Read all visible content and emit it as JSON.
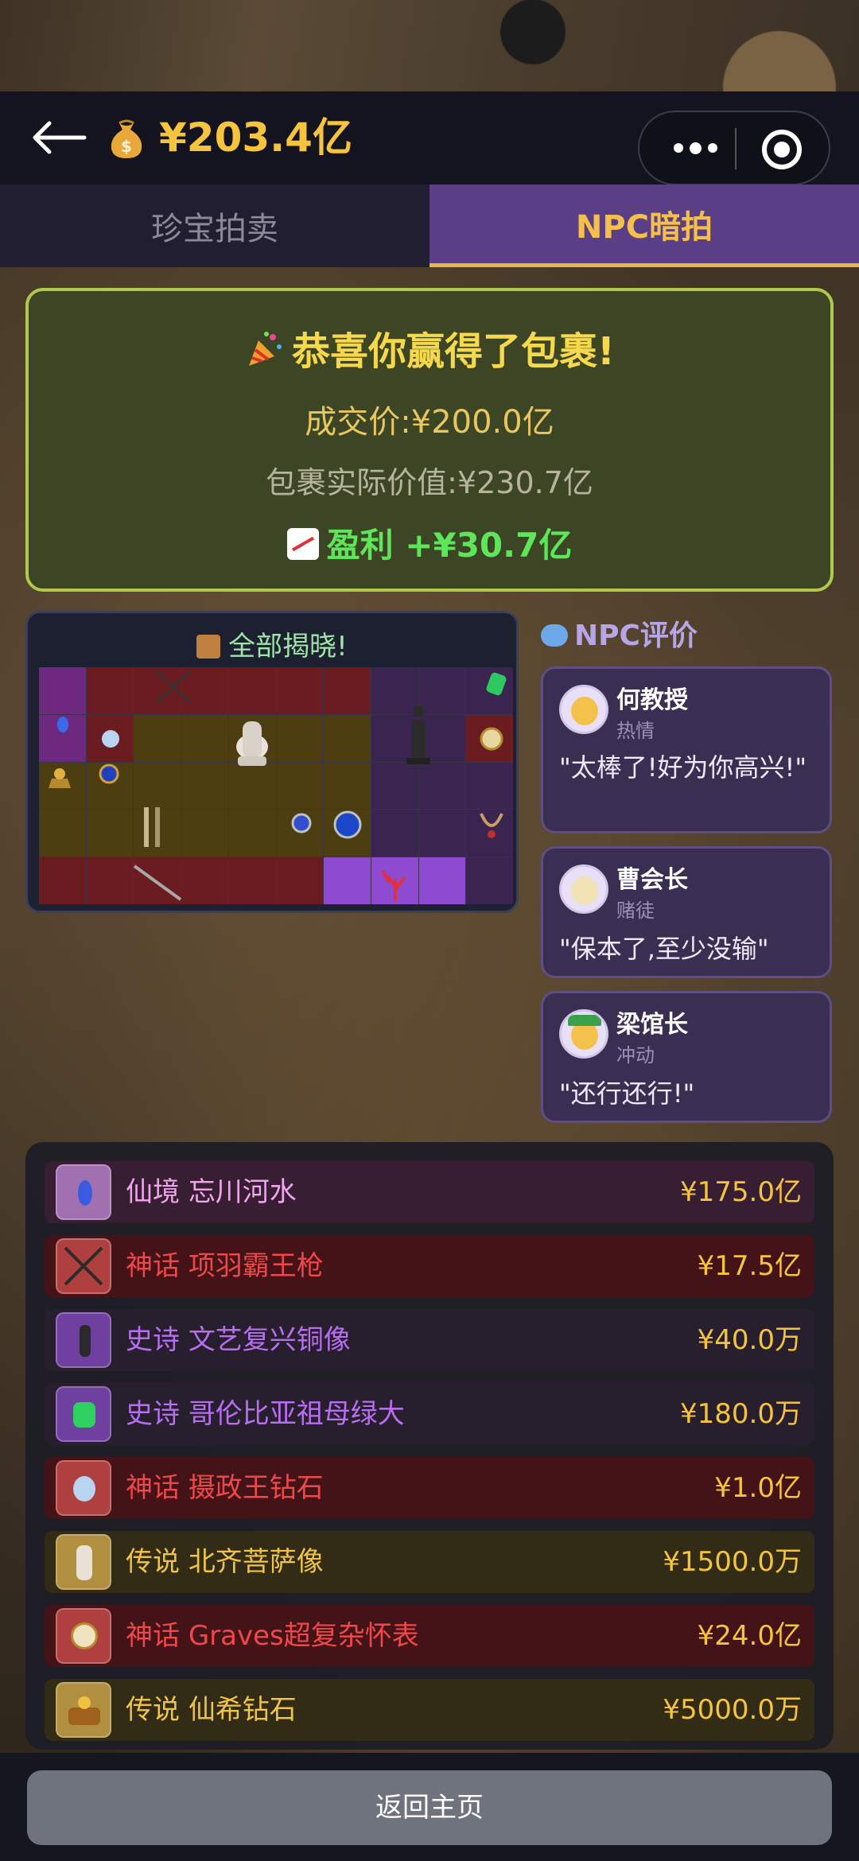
{
  "header": {
    "balance": "¥203.4亿",
    "icons": {
      "back": "arrow-left-icon",
      "coin": "money-bag-icon",
      "more": "more-dots-icon",
      "close": "target-close-icon"
    }
  },
  "tabs": [
    {
      "label": "珍宝拍卖",
      "active": false
    },
    {
      "label": "NPC暗拍",
      "active": true
    }
  ],
  "result": {
    "title": "恭喜你赢得了包裹!",
    "deal_price": "成交价:¥200.0亿",
    "real_value": "包裹实际价值:¥230.7亿",
    "profit": "盈利 +¥30.7亿"
  },
  "reveal": {
    "title": "全部揭晓!"
  },
  "npc_section": {
    "heading": "NPC评价",
    "reviews": [
      {
        "name": "何教授",
        "trait": "热情",
        "quote": "\"太棒了!好为你高兴!\""
      },
      {
        "name": "曹会长",
        "trait": "赌徒",
        "quote": "\"保本了,至少没输\""
      },
      {
        "name": "梁馆长",
        "trait": "冲动",
        "quote": "\"还行还行!\""
      }
    ]
  },
  "items": [
    {
      "rarity": "仙境",
      "name": "忘川河水",
      "price": "¥175.0亿",
      "tier": "pink",
      "icon": "potion-bottle-icon"
    },
    {
      "rarity": "神话",
      "name": "项羽霸王枪",
      "price": "¥17.5亿",
      "tier": "red",
      "icon": "crossed-spears-icon"
    },
    {
      "rarity": "史诗",
      "name": "文艺复兴铜像",
      "price": "¥40.0万",
      "tier": "purple",
      "icon": "bronze-statue-icon"
    },
    {
      "rarity": "史诗",
      "name": "哥伦比亚祖母绿大",
      "price": "¥180.0万",
      "tier": "purple",
      "icon": "emerald-icon"
    },
    {
      "rarity": "神话",
      "name": "摄政王钻石",
      "price": "¥1.0亿",
      "tier": "red",
      "icon": "diamond-icon"
    },
    {
      "rarity": "传说",
      "name": "北齐菩萨像",
      "price": "¥1500.0万",
      "tier": "gold",
      "icon": "bodhisattva-statue-icon"
    },
    {
      "rarity": "神话",
      "name": "Graves超复杂怀表",
      "price": "¥24.0亿",
      "tier": "red",
      "icon": "pocket-watch-icon"
    },
    {
      "rarity": "传说",
      "name": "仙希钻石",
      "price": "¥5000.0万",
      "tier": "gold",
      "icon": "jewel-box-icon"
    }
  ],
  "footer": {
    "home_label": "返回主页"
  },
  "colors": {
    "gold_text": "#f6c43c",
    "profit_green": "#5ee65a",
    "active_tab": "#5a3f86",
    "win_border": "#b0c94c"
  }
}
